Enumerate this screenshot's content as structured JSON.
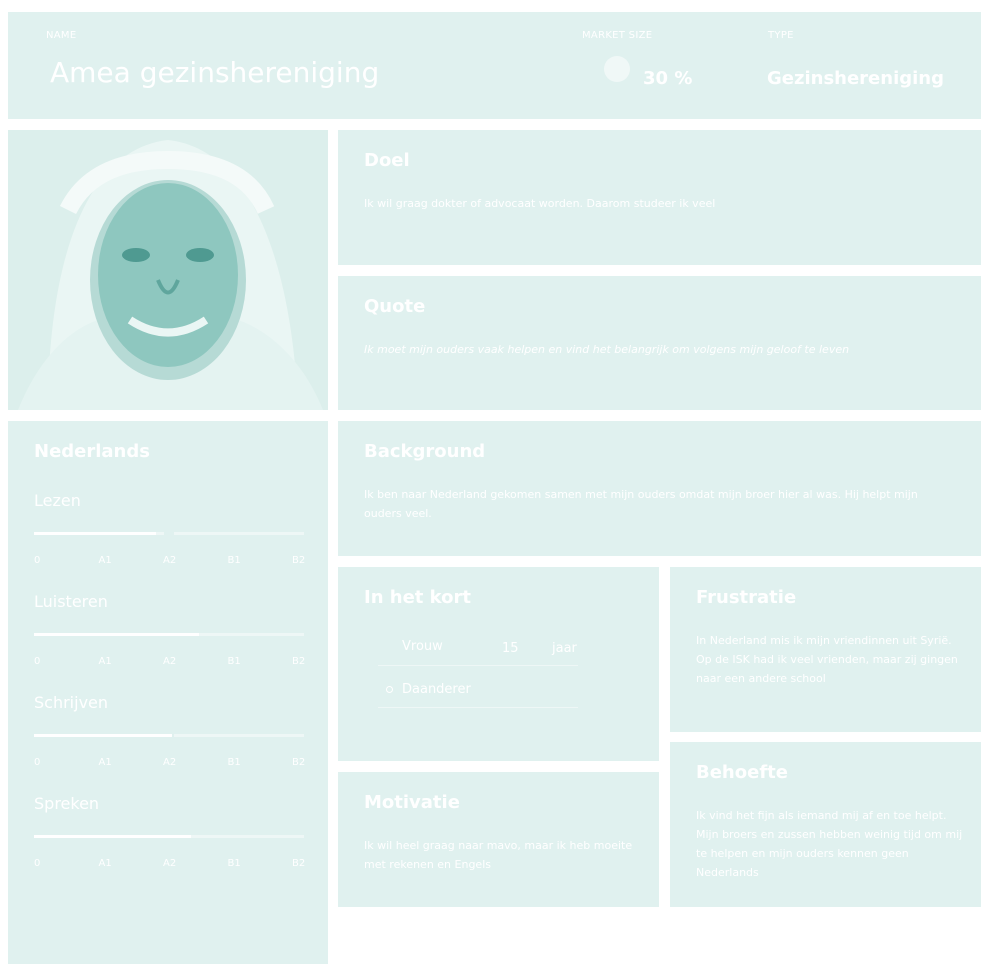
{
  "header": {
    "name_label": "NAME",
    "name": "Amea gezinshereniging",
    "market_label": "MARKET SIZE",
    "market_value": "30 %",
    "type_label": "TYPE",
    "type_value": "Gezinshereniging"
  },
  "doel": {
    "title": "Doel",
    "text": "Ik wil graag dokter of advocaat worden. Daarom studeer ik veel"
  },
  "quote": {
    "title": "Quote",
    "text": "Ik moet mijn ouders vaak helpen en vind het belangrijk om volgens mijn geloof te leven"
  },
  "background": {
    "title": "Background",
    "text": "Ik ben naar Nederland gekomen samen met mijn ouders omdat mijn broer hier al was. Hij helpt mijn ouders veel."
  },
  "kort": {
    "title": "In het kort",
    "gender": "Vrouw",
    "age": "15",
    "age_unit": "jaar",
    "role": "Daanderer"
  },
  "frustratie": {
    "title": "Frustratie",
    "text": "In Nederland mis ik mijn vriendinnen uit Syrië. Op de ISK had ik veel vrienden, maar zij gingen naar een andere school"
  },
  "motivatie": {
    "title": "Motivatie",
    "text": "Ik wil heel graag naar mavo, maar ik heb moeite met rekenen en Engels"
  },
  "behoefte": {
    "title": "Behoefte",
    "text": "Ik vind het fijn als iemand mij af en toe helpt. Mijn broers en zussen hebben weinig tijd om mij te helpen en mijn ouders kennen geen Nederlands"
  },
  "nederlands": {
    "title": "Nederlands",
    "levels": [
      "0",
      "A1",
      "A2",
      "B1",
      "B2"
    ],
    "skills": [
      {
        "name": "Lezen",
        "level": 0.45
      },
      {
        "name": "Luisteren",
        "level": 0.61
      },
      {
        "name": "Schrijven",
        "level": 0.51
      },
      {
        "name": "Spreken",
        "level": 0.58
      }
    ]
  },
  "colors": {
    "card": "#e0f1ef",
    "text": "#ffffff"
  }
}
